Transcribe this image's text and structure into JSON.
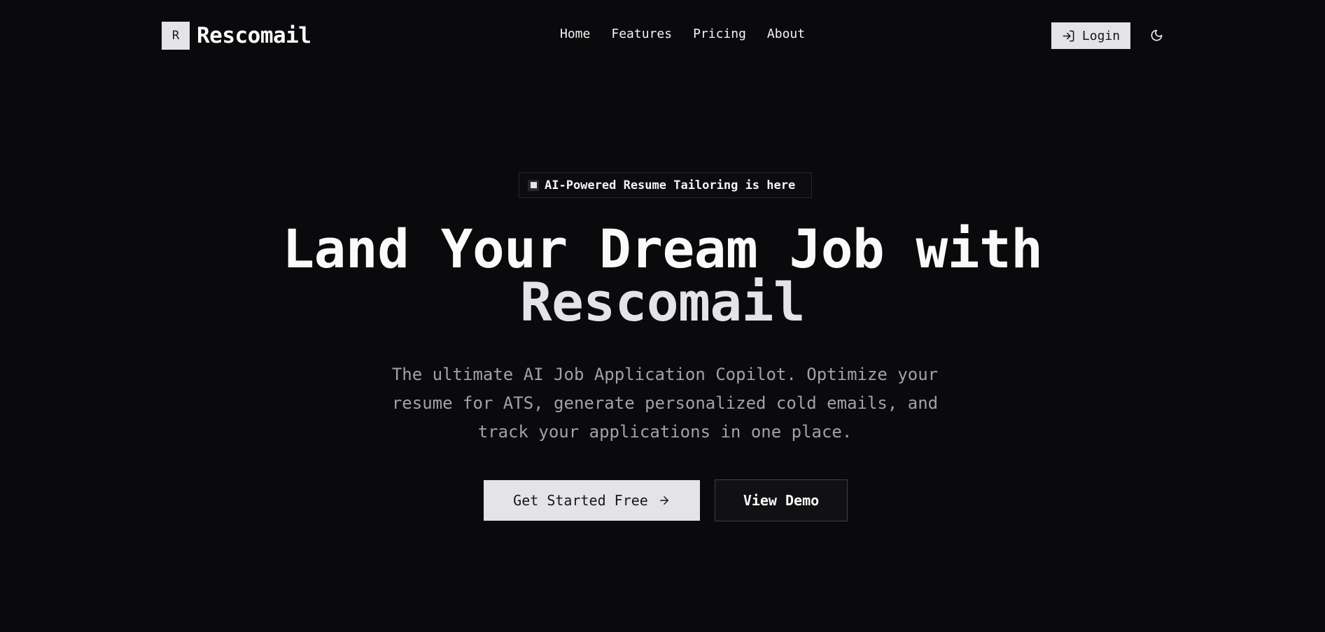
{
  "brand": {
    "logo_letter": "R",
    "name": "Rescomail"
  },
  "nav": {
    "items": [
      {
        "label": "Home"
      },
      {
        "label": "Features"
      },
      {
        "label": "Pricing"
      },
      {
        "label": "About"
      }
    ],
    "login_label": "Login",
    "login_icon": "log-in-icon",
    "theme_icon": "moon-icon"
  },
  "hero": {
    "badge_text": "AI-Powered Resume Tailoring is here",
    "title_line1": "Land Your Dream Job with",
    "title_line2": "Rescomail",
    "subtitle_lines": [
      "The ultimate AI Job Application Copilot. Optimize your",
      "resume for ATS, generate personalized cold emails, and",
      "track your applications in one place."
    ],
    "primary_cta": "Get Started Free",
    "secondary_cta": "View Demo"
  },
  "colors": {
    "background": "#0a0a0c",
    "button_light": "#e4e4e7",
    "text_muted": "#a1a1aa"
  }
}
